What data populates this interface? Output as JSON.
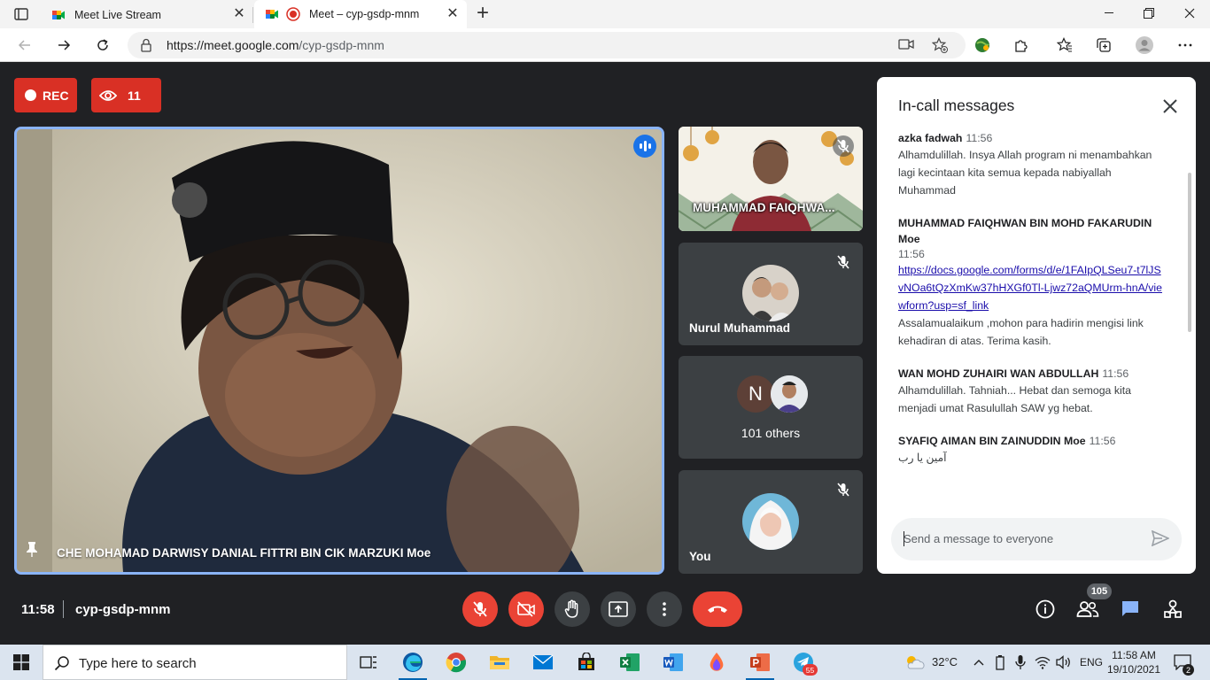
{
  "browser": {
    "tabs": [
      {
        "title": "Meet Live Stream"
      },
      {
        "title": "Meet – cyp-gsdp-mnm"
      }
    ],
    "url_host": "https://meet.google.com",
    "url_path": "/cyp-gsdp-mnm"
  },
  "meet": {
    "rec_label": "REC",
    "viewers_count": "11",
    "main_speaker": "CHE MOHAMAD DARWISY DANIAL FITTRI BIN CIK MARZUKI Moe",
    "tiles": [
      {
        "name": "MUHAMMAD FAIQHWA..."
      },
      {
        "name": "Nurul Muhammad"
      },
      {
        "initial": "N",
        "label": "101 others"
      },
      {
        "name": "You"
      }
    ],
    "time": "11:58",
    "meeting_code": "cyp-gsdp-mnm",
    "people_count": "105"
  },
  "chat": {
    "title": "In-call messages",
    "messages": [
      {
        "sender": "azka fadwah",
        "time": "11:56",
        "text": "Alhamdulillah. Insya Allah program ni menambahkan lagi kecintaan kita semua kepada nabiyallah Muhammad"
      },
      {
        "sender": "MUHAMMAD FAIQHWAN BIN MOHD FAKARUDIN Moe",
        "time": "11:56",
        "link": "https://docs.google.com/forms/d/e/1FAIpQLSeu7-t7lJSvNOa6tQzXmKw37hHXGf0Tl-Ljwz72aQMUrm-hnA/viewform?usp=sf_link",
        "text": "Assalamualaikum ,mohon para hadirin mengisi link kehadiran di atas. Terima kasih."
      },
      {
        "sender": "WAN MOHD ZUHAIRI WAN ABDULLAH",
        "time": "11:56",
        "text": "Alhamdulillah. Tahniah...  Hebat dan semoga kita menjadi umat Rasulullah SAW yg hebat."
      },
      {
        "sender": "SYAFIQ AIMAN BIN ZAINUDDIN Moe",
        "time": "11:56",
        "text": "آمين يا رب"
      }
    ],
    "input_placeholder": "Send a message to everyone"
  },
  "taskbar": {
    "search_placeholder": "Type here to search",
    "telegram_badge": "55",
    "temperature": "32°C",
    "language": "ENG",
    "clock_time": "11:58 AM",
    "clock_date": "19/10/2021",
    "notifications": "2"
  }
}
